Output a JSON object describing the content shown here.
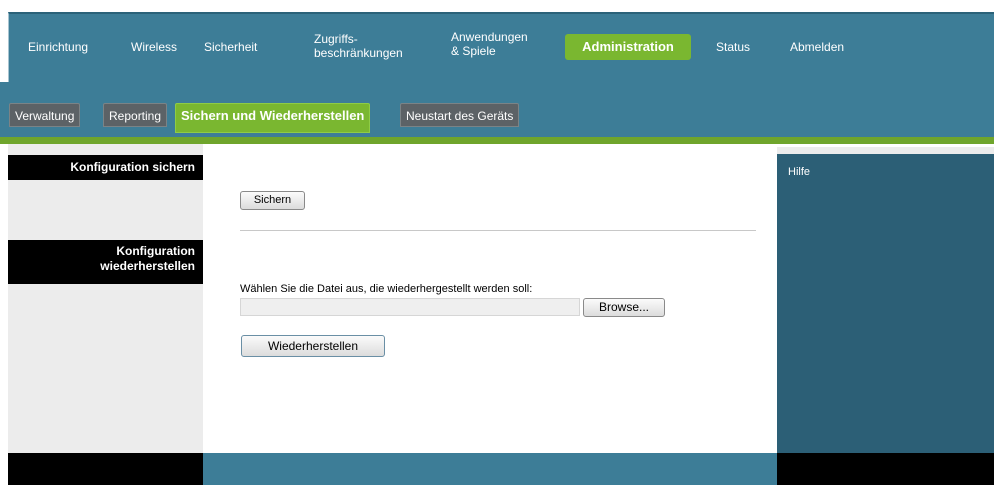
{
  "topnav": {
    "items": [
      {
        "label": "Einrichtung"
      },
      {
        "label": "Wireless"
      },
      {
        "label": "Sicherheit"
      },
      {
        "label": "Zugriffs-\nbeschränkungen"
      },
      {
        "label": "Anwendungen\n& Spiele"
      },
      {
        "label": "Administration",
        "active": true
      },
      {
        "label": "Status"
      },
      {
        "label": "Abmelden"
      }
    ]
  },
  "subtabs": [
    {
      "label": "Verwaltung"
    },
    {
      "label": "Reporting"
    },
    {
      "label": "Sichern und Wiederherstellen",
      "active": true
    },
    {
      "label": "Neustart des Geräts"
    }
  ],
  "sections": {
    "backup_title": "Konfiguration sichern",
    "restore_title": "Konfiguration wiederherstellen"
  },
  "backup": {
    "button": "Sichern"
  },
  "restore": {
    "file_label": "Wählen Sie die Datei aus, die wiederhergestellt werden soll:",
    "file_value": "",
    "browse_button": "Browse...",
    "restore_button": "Wiederherstellen"
  },
  "help": {
    "label": "Hilfe"
  },
  "colors": {
    "nav_bg": "#3d7d97",
    "accent": "#7ab730",
    "help_bg": "#2c5f76"
  }
}
